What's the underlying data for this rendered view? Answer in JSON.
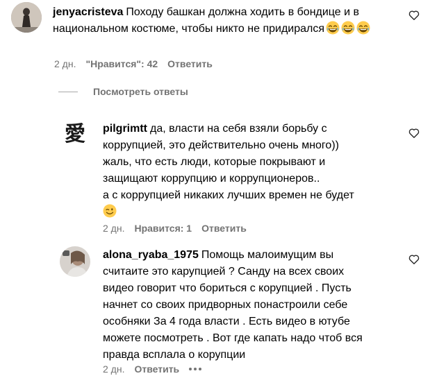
{
  "comments": [
    {
      "username": "jenyacristeva",
      "text": "Походу башкан должна ходить в бондице и в национальном костюме, чтобы никто не придирался",
      "time": "2 дн.",
      "likes": "\"Нравится\": 42",
      "reply": "Ответить"
    },
    {
      "username": "pilgrimtt",
      "text_lines": [
        "да, власти на себя взяли борьбу с",
        "коррупцией, это действительно очень много))",
        "жаль, что есть люди, которые покрывают и",
        "защищают коррупцию и коррупционеров..",
        "а с коррупцией никаких лучших времен не будет"
      ],
      "avatar_glyph": "愛",
      "time": "2 дн.",
      "likes": "Нравится: 1",
      "reply": "Ответить"
    },
    {
      "username": "alona_ryaba_1975",
      "text_lines": [
        "Помощь малоимущим вы",
        "считаите это карупцией ? Санду на всех своих",
        "видео говорит что бориться с корупцией . Пусть",
        "начнет со своих придворных понастроили себе",
        "особняки За 4 года власти . Есть видео в ютубе",
        "можете посмотреть . Вот где капать надо чтоб вся",
        "правда всплала о корупции"
      ],
      "time": "2 дн.",
      "reply": "Ответить"
    }
  ],
  "view_replies": "Посмотреть ответы"
}
